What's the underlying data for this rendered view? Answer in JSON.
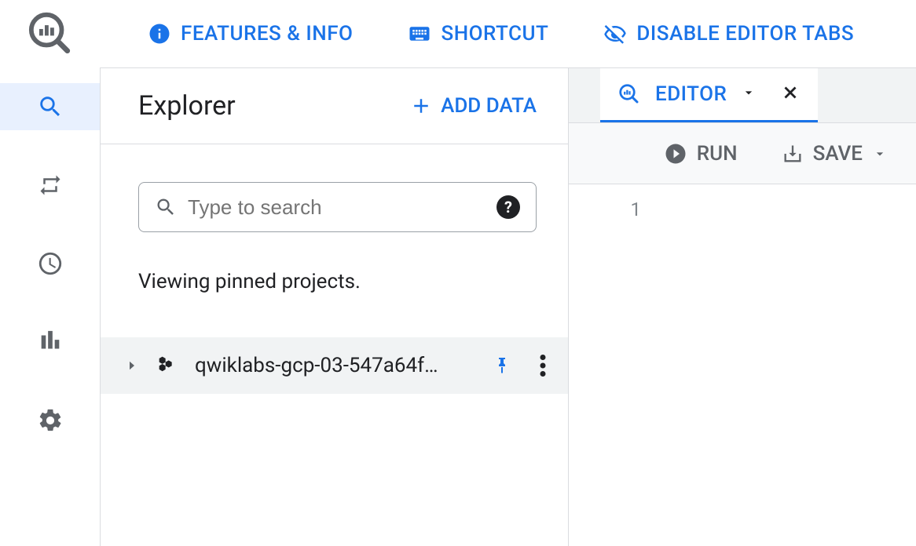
{
  "topbar": {
    "features_label": "FEATURES & INFO",
    "shortcut_label": "SHORTCUT",
    "disable_tabs_label": "DISABLE EDITOR TABS"
  },
  "explorer": {
    "title": "Explorer",
    "add_data_label": "ADD DATA",
    "search_placeholder": "Type to search",
    "status_text": "Viewing pinned projects.",
    "project_name": "qwiklabs-gcp-03-547a64f…"
  },
  "editor": {
    "tab_label": "EDITOR",
    "run_label": "RUN",
    "save_label": "SAVE",
    "line_number": "1"
  }
}
